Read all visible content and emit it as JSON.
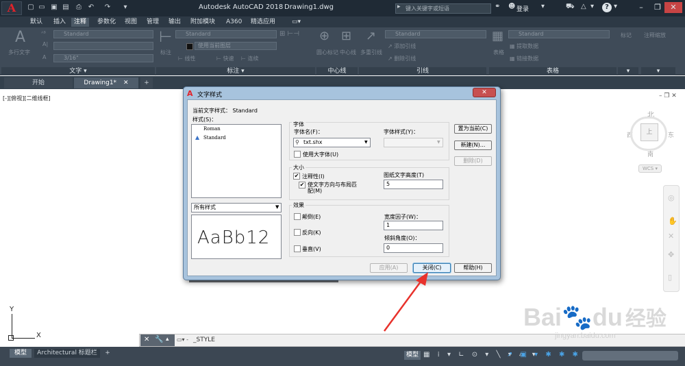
{
  "titlebar": {
    "app_logo": "A",
    "title": "Autodesk AutoCAD 2018",
    "document": "Drawing1.dwg",
    "search_placeholder": "键入关键字或短语",
    "login": "登录",
    "help": "?"
  },
  "ribbon_tabs": [
    "默认",
    "插入",
    "注释",
    "参数化",
    "视图",
    "管理",
    "输出",
    "附加模块",
    "A360",
    "精选应用"
  ],
  "active_tab": "注释",
  "ribbon": {
    "text_panel": {
      "big_label": "多行文字",
      "style_value": "Standard",
      "height_value": "3/16\"",
      "label": "文字 ▾"
    },
    "dim_panel": {
      "style_value": "Standard",
      "layer_value": "使用当前图层",
      "small_labels": [
        "线性",
        "快速",
        "连续"
      ],
      "big_label": "标注",
      "label": "标注 ▾"
    },
    "centerline_panel": {
      "items": [
        "圆心标记",
        "中心线"
      ],
      "label": "中心线"
    },
    "leader_panel": {
      "big_label": "多重引线",
      "style_value": "Standard",
      "items": [
        "添加引线",
        "删除引线"
      ],
      "label": "引线"
    },
    "table_panel": {
      "big_label": "表格",
      "style_value": "Standard",
      "items": [
        "提取数据",
        "链接数据"
      ],
      "label": "表格"
    },
    "markup_panel": {
      "big_label": "标记",
      "label": "▾"
    },
    "scale_panel": {
      "big_label": "注释缩放",
      "label": "▾"
    }
  },
  "file_tabs": [
    "开始",
    "Drawing1*"
  ],
  "viewport_label": "[-][俯视][二维线框]",
  "viewcube": {
    "north": "北",
    "south": "南",
    "east": "东",
    "west": "西",
    "top": "上",
    "wcs": "WCS"
  },
  "ucs": {
    "y": "Y",
    "x": "X"
  },
  "command_line": {
    "text": "_STYLE"
  },
  "status": {
    "model_tab": "模型",
    "layout_tab": "Architectural 标题栏",
    "model_button": "模型"
  },
  "dialog": {
    "title": "文字样式",
    "current_style_label": "当前文字样式： Standard",
    "styles_label": "样式(S)：",
    "styles": [
      "Roman",
      "Standard"
    ],
    "filter_value": "所有样式",
    "preview_text": "AaBb12",
    "font_group": "字体",
    "font_name_label": "字体名(F)：",
    "font_name_value": "txt.shx",
    "font_style_label": "字体样式(Y)：",
    "bigfont_label": "使用大字体(U)",
    "size_group": "大小",
    "annotative_label": "注释性(I)",
    "match_orientation_label": "使文字方向与布局匹配(M)",
    "paper_height_label": "图纸文字高度(T)",
    "paper_height_value": "5",
    "effects_group": "效果",
    "upside_down_label": "颠倒(E)",
    "backwards_label": "反向(K)",
    "vertical_label": "垂直(V)",
    "width_factor_label": "宽度因子(W)：",
    "width_factor_value": "1",
    "oblique_label": "倾斜角度(O)：",
    "oblique_value": "0",
    "btn_set_current": "置为当前(C)",
    "btn_new": "新建(N)...",
    "btn_delete": "删除(D)",
    "btn_apply": "应用(A)",
    "btn_close": "关闭(C)",
    "btn_help": "帮助(H)"
  },
  "watermark": {
    "brand": "Bai",
    "brand2": "du",
    "cn": "经验",
    "url": "jingyan.baidu.com"
  },
  "colors": {
    "accent_red": "#e2232a",
    "ribbon_bg": "#3f4b58",
    "annotation_arrow": "#e8322c"
  }
}
